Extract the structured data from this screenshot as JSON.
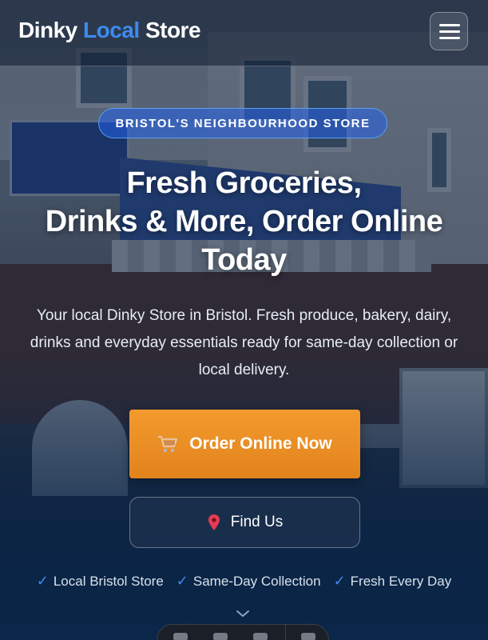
{
  "brand": {
    "part1": "Dinky",
    "part2": "Local",
    "part3": "Store",
    "accent_color": "#3d8bf0"
  },
  "navbar": {
    "menu_icon": "hamburger-icon"
  },
  "hero": {
    "badge": "BRISTOL'S NEIGHBOURHOOD STORE",
    "headline_line1": "Fresh Groceries,",
    "headline_line2": "Drinks & More, Order Online",
    "headline_line3": "Today",
    "subtext": "Your local Dinky Store in Bristol. Fresh produce, bakery, dairy, drinks and everyday essentials ready for same-day collection or local delivery.",
    "primary_button": {
      "label": "Order Online Now",
      "icon": "shopping-cart-icon",
      "color": "#f0932b"
    },
    "secondary_button": {
      "label": "Find Us",
      "icon": "map-pin-icon"
    },
    "features": [
      {
        "check": "✓",
        "label": "Local Bristol Store"
      },
      {
        "check": "✓",
        "label": "Same-Day Collection"
      },
      {
        "check": "✓",
        "label": "Fresh Every Day"
      }
    ],
    "scroll_icon": "chevron-down-icon"
  }
}
